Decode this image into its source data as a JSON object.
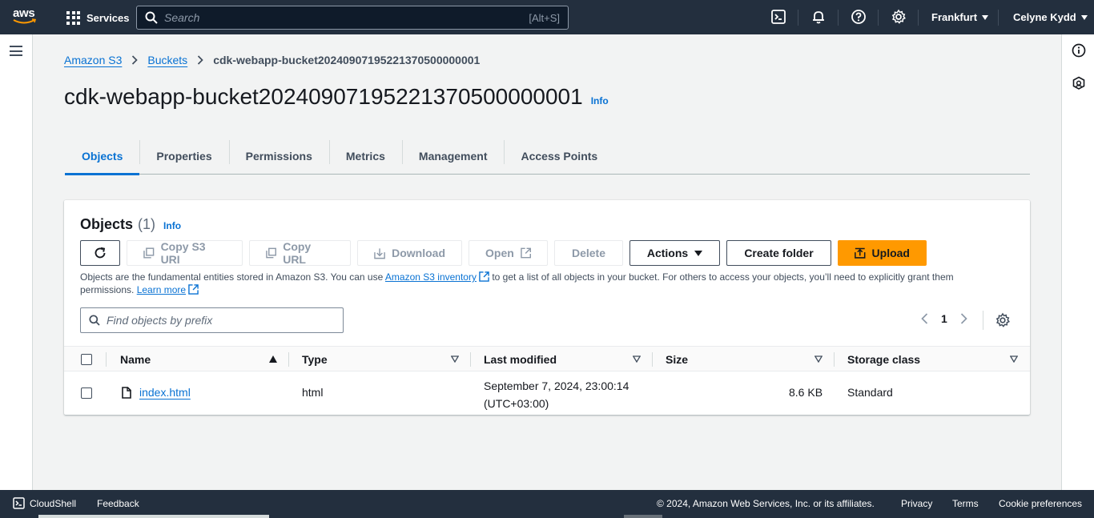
{
  "topnav": {
    "logo": "aws",
    "services_label": "Services",
    "search_placeholder": "Search",
    "search_shortcut": "[Alt+S]",
    "region": "Frankfurt",
    "user": "Celyne Kydd"
  },
  "breadcrumb": {
    "items": [
      "Amazon S3",
      "Buckets"
    ],
    "current": "cdk-webapp-bucket20240907195221370500000001"
  },
  "page": {
    "title": "cdk-webapp-bucket20240907195221370500000001",
    "info": "Info"
  },
  "tabs": [
    "Objects",
    "Properties",
    "Permissions",
    "Metrics",
    "Management",
    "Access Points"
  ],
  "active_tab": "Objects",
  "objects": {
    "title": "Objects",
    "count": "(1)",
    "info": "Info",
    "buttons": {
      "copy_s3_uri": "Copy S3 URI",
      "copy_url": "Copy URL",
      "download": "Download",
      "open": "Open",
      "delete": "Delete",
      "actions": "Actions",
      "create_folder": "Create folder",
      "upload": "Upload"
    },
    "description_1": "Objects are the fundamental entities stored in Amazon S3. You can use",
    "description_link": "Amazon S3 inventory",
    "description_2": "to get a list of all objects in your bucket. For others to access your objects, you’ll need to explicitly grant them permissions.",
    "learn_more": "Learn more",
    "filter_placeholder": "Find objects by prefix",
    "page_number": "1",
    "columns": [
      "Name",
      "Type",
      "Last modified",
      "Size",
      "Storage class"
    ],
    "rows": [
      {
        "name": "index.html",
        "type": "html",
        "last_modified_1": "September 7, 2024, 23:00:14",
        "last_modified_2": "(UTC+03:00)",
        "size": "8.6 KB",
        "storage_class": "Standard"
      }
    ]
  },
  "footer": {
    "cloudshell": "CloudShell",
    "feedback": "Feedback",
    "copyright": "© 2024, Amazon Web Services, Inc. or its affiliates.",
    "privacy": "Privacy",
    "terms": "Terms",
    "cookie": "Cookie preferences"
  },
  "colors": {
    "nav_bg": "#232f3e",
    "link": "#0972d3",
    "primary_button": "#ff9900"
  }
}
